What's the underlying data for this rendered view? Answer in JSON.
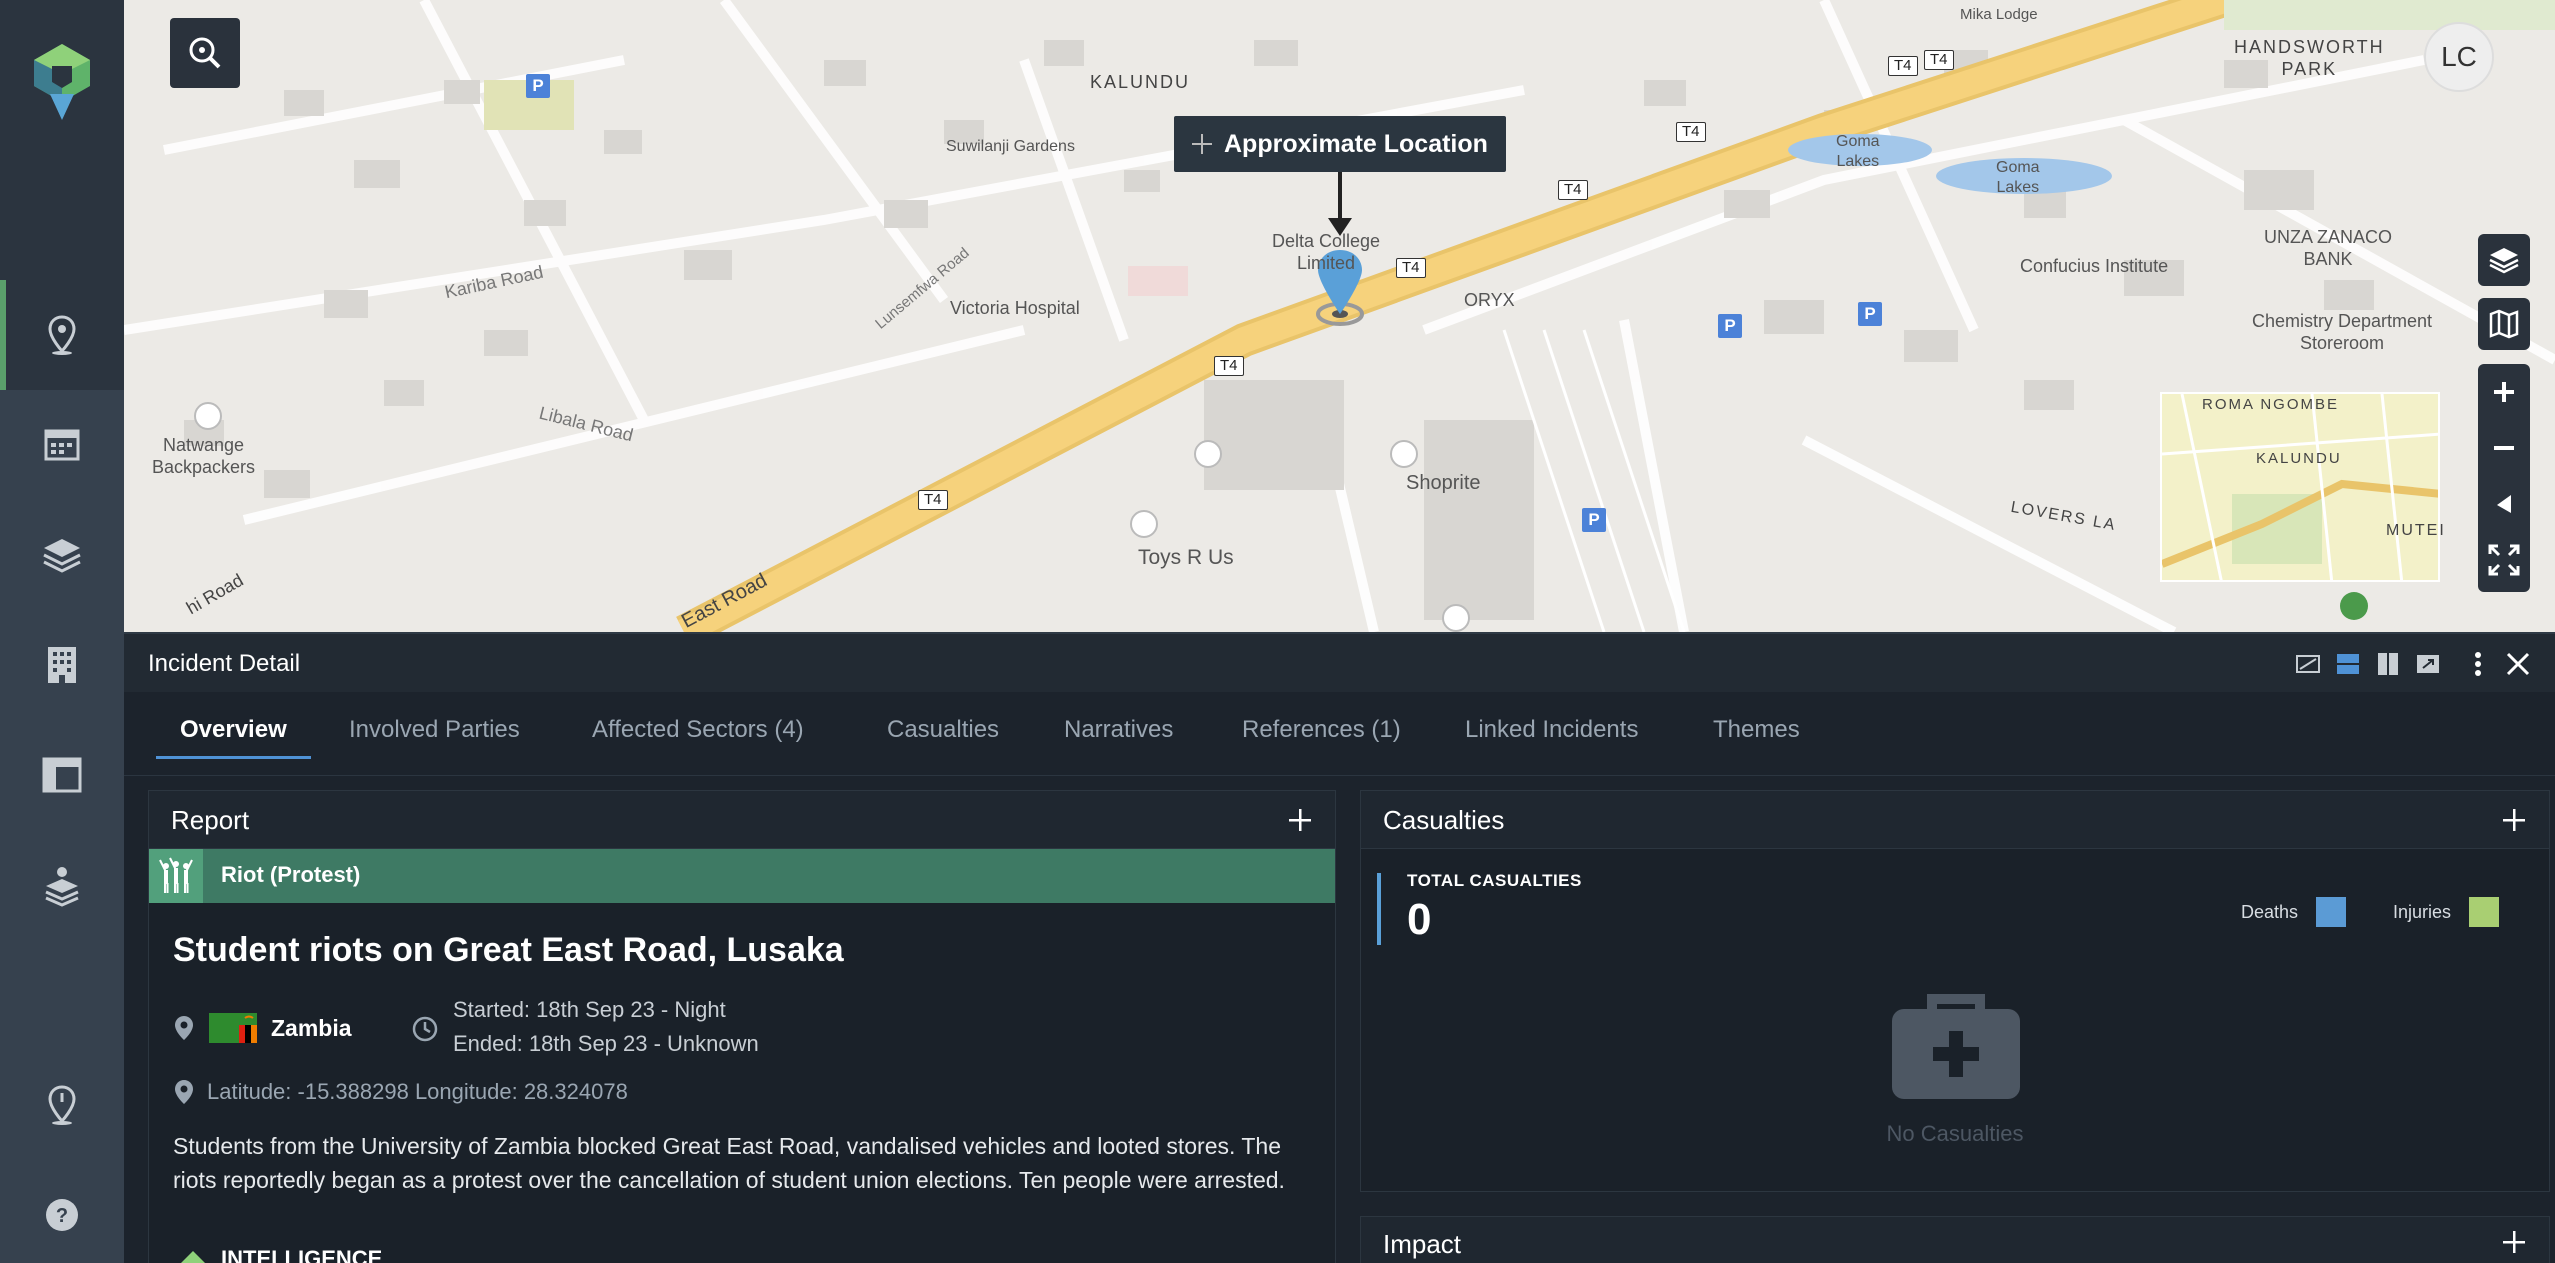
{
  "sidebar": {
    "items": [
      {
        "name": "map-marker-icon",
        "active": true
      },
      {
        "name": "calendar-icon"
      },
      {
        "name": "layers-icon"
      },
      {
        "name": "building-icon"
      },
      {
        "name": "layout-icon"
      },
      {
        "name": "stack-icon"
      },
      {
        "name": "location-pin-icon"
      },
      {
        "name": "help-icon"
      }
    ]
  },
  "user": {
    "initials": "LC"
  },
  "map": {
    "tooltip": "Approximate Location",
    "labels": {
      "kalundu": "KALUNDU",
      "handsworth": "HANDSWORTH\nPARK",
      "mika": "Mika Lodge",
      "suwilanji": "Suwilanji Gardens",
      "goma1": "Goma\nLakes",
      "goma2": "Goma\nLakes",
      "unza": "UNZA ZANACO\nBANK",
      "confucius": "Confucius Institute",
      "chemistry": "Chemistry Department\nStoreroom",
      "delta": "Delta College\nLimited",
      "oryx": "ORYX",
      "victoria": "Victoria Hospital",
      "kariba": "Kariba Road",
      "lunsemfwa": "Lunsemfwa Road",
      "libala": "Libala Road",
      "natwange": "Natwange\nBackpackers",
      "shoprite": "Shoprite",
      "toys": "Toys R Us",
      "east_road": "East Road",
      "road_left": "hi Road",
      "roma": "ROMA NGOMBE",
      "kalundu_mini": "KALUNDU",
      "lovers": "LOVERS LA",
      "mutei": "MUTEI",
      "t4": "T4",
      "p": "P"
    }
  },
  "panel": {
    "title": "Incident Detail",
    "tabs": [
      "Overview",
      "Involved Parties",
      "Affected Sectors (4)",
      "Casualties",
      "Narratives",
      "References (1)",
      "Linked Incidents",
      "Themes"
    ]
  },
  "report": {
    "card_title": "Report",
    "incident_type": "Riot (Protest)",
    "title": "Student riots on Great East Road, Lusaka",
    "country": "Zambia",
    "started": "Started: 18th Sep 23 - Night",
    "ended": "Ended: 18th Sep 23 - Unknown",
    "coordinates": "Latitude: -15.388298 Longitude: 28.324078",
    "description": "Students from the University of Zambia blocked Great East Road, vandalised vehicles and looted stores. The riots reportedly began as a protest over the cancellation of student union elections. Ten people were arrested.",
    "next_section": "INTELLIGENCE"
  },
  "casualties": {
    "card_title": "Casualties",
    "total_label": "TOTAL CASUALTIES",
    "total": "0",
    "legend": [
      {
        "label": "Deaths",
        "color": "#5b9bd5"
      },
      {
        "label": "Injuries",
        "color": "#a9cf72"
      }
    ],
    "empty_text": "No Casualties"
  },
  "impact": {
    "card_title": "Impact"
  },
  "colors": {
    "accent_blue": "#4f92d6",
    "type_green": "#3e7a64",
    "road_yellow": "#f6d27c"
  }
}
